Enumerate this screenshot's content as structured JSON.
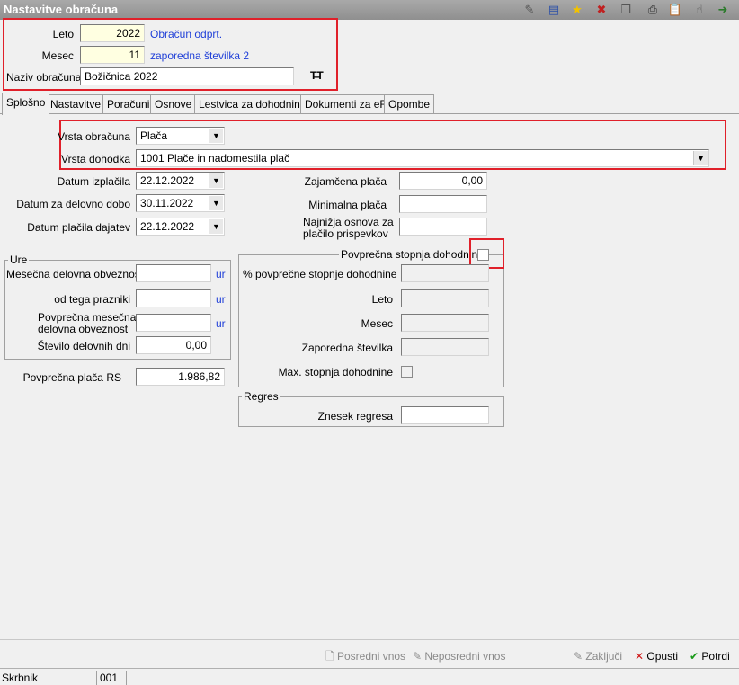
{
  "window": {
    "title": "Nastavitve obračuna"
  },
  "header": {
    "leto_label": "Leto",
    "leto_value": "2022",
    "leto_status": "Obračun odprt.",
    "mesec_label": "Mesec",
    "mesec_value": "11",
    "mesec_status": "zaporedna številka 2",
    "naziv_label": "Naziv obračuna",
    "naziv_value": "Božičnica 2022"
  },
  "tabs": [
    "Splošno",
    "Nastavitve",
    "Poračuni",
    "Osnove",
    "Lestvica za dohodnino",
    "Dokumenti za eR",
    "Opombe"
  ],
  "general": {
    "vrsta_obracuna_label": "Vrsta obračuna",
    "vrsta_obracuna_value": "Plača",
    "vrsta_dohodka_label": "Vrsta dohodka",
    "vrsta_dohodka_value": "1001  Plače in nadomestila plač",
    "datum_izplacila_label": "Datum izplačila",
    "datum_izplacila_value": "22.12.2022",
    "datum_delovno_label": "Datum za delovno dobo",
    "datum_delovno_value": "30.11.2022",
    "datum_placila_label": "Datum plačila dajatev",
    "datum_placila_value": "22.12.2022",
    "zajamcena_label": "Zajamčena plača",
    "zajamcena_value": "0,00",
    "minimalna_label": "Minimalna plača",
    "minimalna_value": "",
    "najnizja_label_1": "Najnižja osnova za",
    "najnizja_label_2": "plačilo prispevkov",
    "najnizja_value": ""
  },
  "ure": {
    "title": "Ure",
    "mesecna_label": "Mesečna delovna obveznost",
    "mesecna_value": "",
    "prazniki_label": "od tega prazniki",
    "prazniki_value": "",
    "povprecna_label_1": "Povprečna mesečna",
    "povprecna_label_2": "delovna obveznost",
    "povprecna_value": "",
    "stevilo_label": "Število delovnih dni",
    "stevilo_value": "0,00",
    "unit": "ur"
  },
  "povprecna_placa_label": "Povprečna plača RS",
  "povprecna_placa_value": "1.986,82",
  "dohodnina": {
    "title": "Povprečna stopnja dohodnine",
    "odstotek_label": "% povprečne stopnje dohodnine",
    "leto_label": "Leto",
    "mesec_label": "Mesec",
    "zaporedna_label": "Zaporedna številka",
    "max_label": "Max. stopnja dohodnine"
  },
  "regres": {
    "title": "Regres",
    "znesek_label": "Znesek regresa",
    "znesek_value": ""
  },
  "buttons": {
    "posredni": "Posredni vnos",
    "neposredni": "Neposredni vnos",
    "zakljuci": "Zaključi",
    "opusti": "Opusti",
    "potrdi": "Potrdi"
  },
  "status": {
    "user": "Skrbnik",
    "code": "001"
  },
  "colors": {
    "highlight": "#e0202a",
    "link": "#1f3fd8",
    "input_yellow": "#ffffe1"
  }
}
